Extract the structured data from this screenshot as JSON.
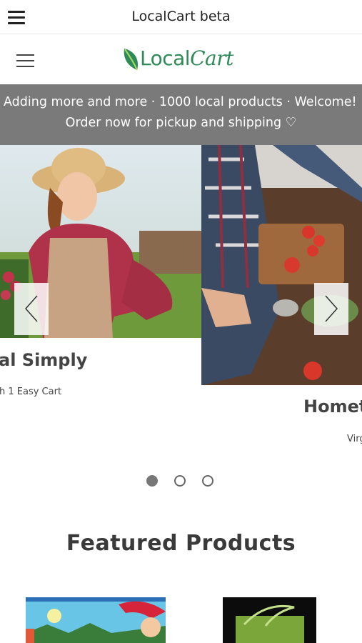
{
  "app_bar": {
    "title": "LocalCart beta"
  },
  "logo": {
    "text_local": "Local",
    "text_cart": "Cart"
  },
  "announcement": {
    "line1": "Adding more and more · 1000 local products · Welcome! ·",
    "line2": "Order now for pickup and shipping ♡"
  },
  "carousel": {
    "slides": [
      {
        "title": "al Simply",
        "subtitle": "h 1 Easy Cart"
      },
      {
        "title": "Homet",
        "subtitle": "Virg"
      }
    ],
    "dots": 3,
    "active_dot": 0
  },
  "featured": {
    "title": "Featured Products"
  },
  "colors": {
    "brand_green": "#2e8b57",
    "banner_gray": "#7a7a7a"
  }
}
